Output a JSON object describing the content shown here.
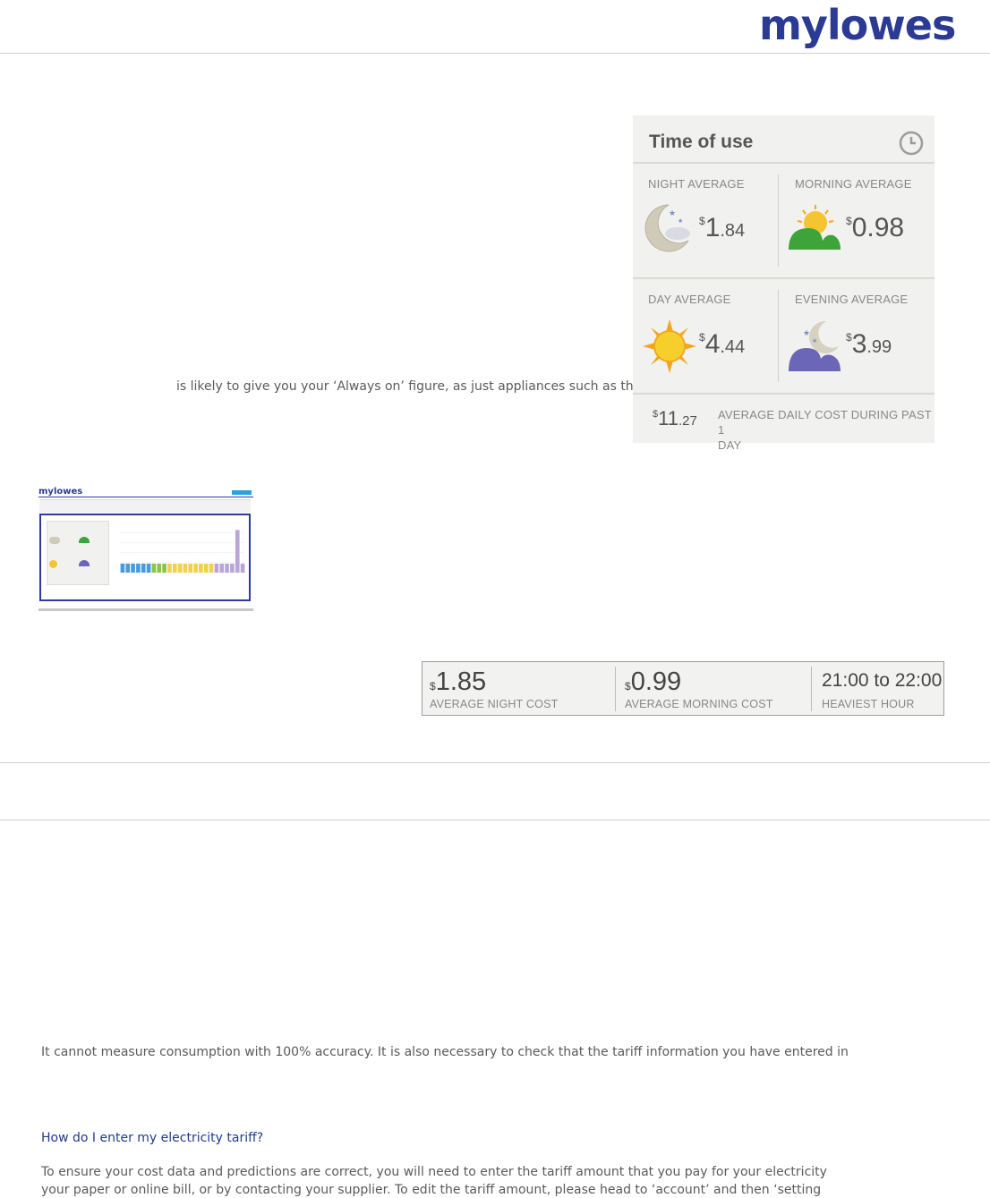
{
  "brand": {
    "logo": "mylowes"
  },
  "intro": {
    "text": "is likely to give you your ‘Always on’ figure, as just appliances such as the"
  },
  "time_of_use": {
    "title": "Time of use",
    "cells": [
      {
        "label": "NIGHT AVERAGE",
        "currency": "$",
        "whole": "1",
        "fraction": ".84",
        "icon": "night-moon-icon"
      },
      {
        "label": "MORNING AVERAGE",
        "currency": "$",
        "whole": "0.98",
        "fraction": "",
        "icon": "morning-sunrise-icon"
      },
      {
        "label": "DAY AVERAGE",
        "currency": "$",
        "whole": "4",
        "fraction": ".44",
        "icon": "sun-icon"
      },
      {
        "label": "EVENING AVERAGE",
        "currency": "$",
        "whole": "3",
        "fraction": ".99",
        "icon": "evening-moon-icon"
      }
    ],
    "daily": {
      "currency": "$",
      "whole": "11",
      "fraction": ".27",
      "label_line1": "AVERAGE DAILY COST DURING PAST 1",
      "label_line2": "DAY"
    }
  },
  "summary_bar": [
    {
      "currency": "$",
      "value": "1.85",
      "label": "AVERAGE NIGHT COST"
    },
    {
      "currency": "$",
      "value": "0.99",
      "label": "AVERAGE MORNING COST"
    },
    {
      "currency": "",
      "value": "21:00 to 22:00",
      "label": "HEAVIEST HOUR"
    }
  ],
  "thumbnail": {
    "logo": "mylowes",
    "bars": [
      0.18,
      0.18,
      0.18,
      0.18,
      0.18,
      0.18,
      0.18,
      0.18,
      0.18,
      0.18,
      0.18,
      0.18,
      0.18,
      0.18,
      0.18,
      0.18,
      0.18,
      0.18,
      0.18,
      0.18,
      0.18,
      0.18,
      0.85,
      0.18
    ],
    "colors": {
      "night": "#4a9ad8",
      "morning": "#8bc34a",
      "day": "#f0d14a",
      "evening": "#b8a6d9"
    }
  },
  "faq": {
    "accuracy_text": "It cannot measure consumption with 100% accuracy. It is also necessary to check that the tariff information you have entered in",
    "tariff_heading": "How do I enter my electricity tariff?",
    "tariff_line1": "To ensure your cost data and predictions are correct, you will need to enter the tariff amount that you pay for your electricity",
    "tariff_line2": "your paper or online bill, or by contacting your supplier. To edit the tariff amount, please head to ‘account’ and then ‘setting"
  },
  "colors": {
    "brand": "#2b3a93",
    "panel": "#f1f1ef",
    "text": "#5a5a5a"
  }
}
